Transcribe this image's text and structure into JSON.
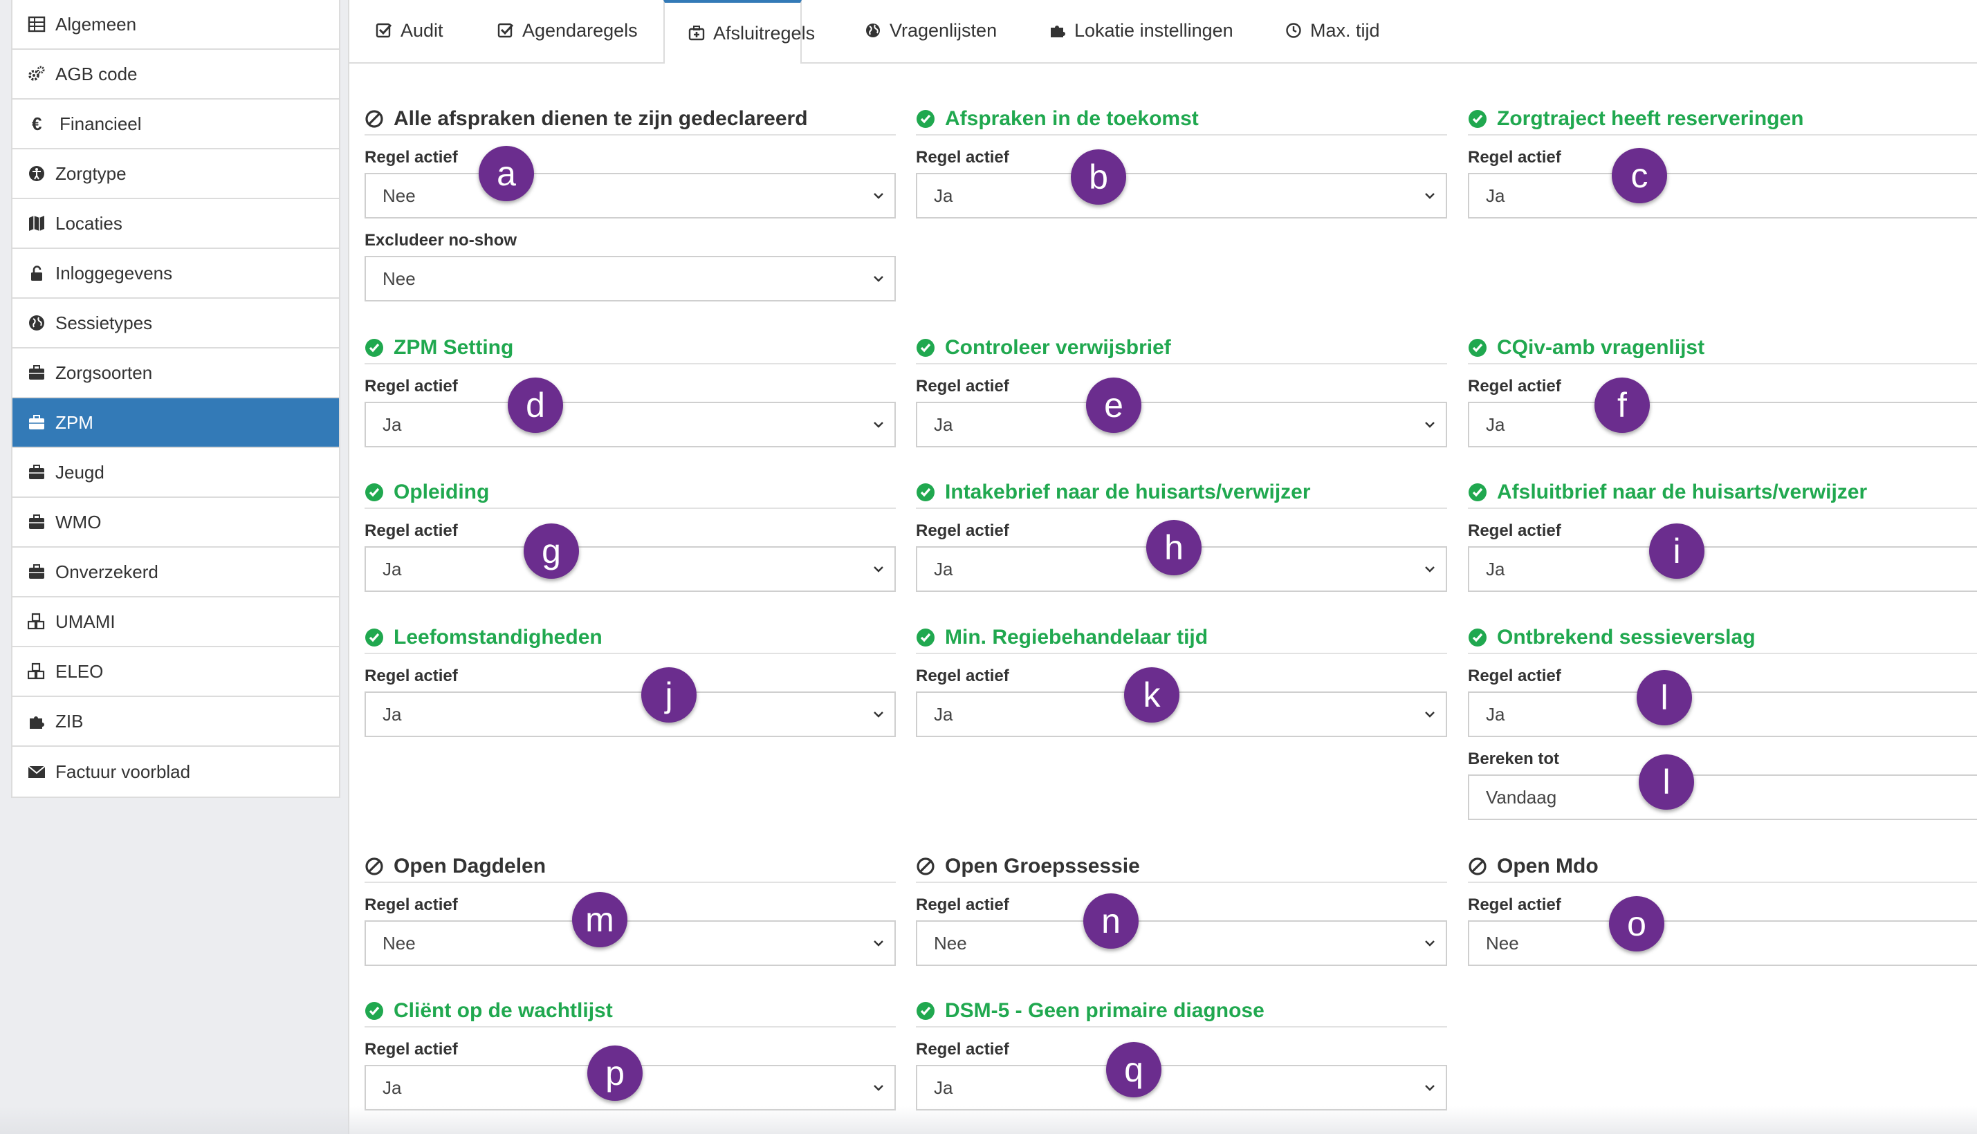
{
  "sidebar": {
    "items": [
      {
        "label": "Algemeen",
        "icon": "table-icon"
      },
      {
        "label": "AGB code",
        "icon": "gears-icon"
      },
      {
        "label": "Financieel",
        "icon": "euro-icon"
      },
      {
        "label": "Zorgtype",
        "icon": "universal-access-icon"
      },
      {
        "label": "Locaties",
        "icon": "map-icon"
      },
      {
        "label": "Inloggegevens",
        "icon": "unlock-icon"
      },
      {
        "label": "Sessietypes",
        "icon": "globe-icon"
      },
      {
        "label": "Zorgsoorten",
        "icon": "briefcase-icon"
      },
      {
        "label": "ZPM",
        "icon": "briefcase-icon",
        "active": true
      },
      {
        "label": "Jeugd",
        "icon": "briefcase-icon"
      },
      {
        "label": "WMO",
        "icon": "briefcase-icon"
      },
      {
        "label": "Onverzekerd",
        "icon": "briefcase-icon"
      },
      {
        "label": "UMAMI",
        "icon": "cubes-icon"
      },
      {
        "label": "ELEO",
        "icon": "cubes-icon"
      },
      {
        "label": "ZIB",
        "icon": "puzzle-icon"
      },
      {
        "label": "Factuur voorblad",
        "icon": "envelope-icon"
      }
    ]
  },
  "tabs": [
    {
      "label": "Audit",
      "icon": "check-square-icon"
    },
    {
      "label": "Agendaregels",
      "icon": "check-square-icon"
    },
    {
      "label": "Afsluitregels",
      "icon": "medkit-icon",
      "active": true
    },
    {
      "label": "Vragenlijsten",
      "icon": "globe-icon"
    },
    {
      "label": "Lokatie instellingen",
      "icon": "puzzle-icon"
    },
    {
      "label": "Max. tijd",
      "icon": "clock-icon"
    }
  ],
  "labels": {
    "regel_actief": "Regel actief",
    "excludeer_no_show": "Excludeer no-show",
    "bereken_tot": "Bereken tot"
  },
  "rules": [
    {
      "title": "Alle afspraken dienen te zijn gedeclareerd",
      "status": "disabled",
      "regel_actief": "Nee",
      "excludeer_no_show": "Nee",
      "marker": "a"
    },
    {
      "title": "Afspraken in de toekomst",
      "status": "enabled",
      "regel_actief": "Ja",
      "marker": "b"
    },
    {
      "title": "Zorgtraject heeft reserveringen",
      "status": "enabled",
      "regel_actief": "Ja",
      "marker": "c"
    },
    {
      "title": "ZPM Setting",
      "status": "enabled",
      "regel_actief": "Ja",
      "marker": "d"
    },
    {
      "title": "Controleer verwijsbrief",
      "status": "enabled",
      "regel_actief": "Ja",
      "marker": "e"
    },
    {
      "title": "CQiv-amb vragenlijst",
      "status": "enabled",
      "regel_actief": "Ja",
      "marker": "f"
    },
    {
      "title": "Opleiding",
      "status": "enabled",
      "regel_actief": "Ja",
      "marker": "g"
    },
    {
      "title": "Intakebrief naar de huisarts/verwijzer",
      "status": "enabled",
      "regel_actief": "Ja",
      "marker": "h"
    },
    {
      "title": "Afsluitbrief naar de huisarts/verwijzer",
      "status": "enabled",
      "regel_actief": "Ja",
      "marker": "i"
    },
    {
      "title": "Leefomstandigheden",
      "status": "enabled",
      "regel_actief": "Ja",
      "marker": "j"
    },
    {
      "title": "Min. Regiebehandelaar tijd",
      "status": "enabled",
      "regel_actief": "Ja",
      "marker": "k"
    },
    {
      "title": "Ontbrekend sessieverslag",
      "status": "enabled",
      "regel_actief": "Ja",
      "bereken_tot": "Vandaag",
      "marker": "l",
      "marker2": "l"
    },
    {
      "title": "Open Dagdelen",
      "status": "disabled",
      "regel_actief": "Nee",
      "marker": "m"
    },
    {
      "title": "Open Groepssessie",
      "status": "disabled",
      "regel_actief": "Nee",
      "marker": "n"
    },
    {
      "title": "Open Mdo",
      "status": "disabled",
      "regel_actief": "Nee",
      "marker": "o"
    },
    {
      "title": "Cliënt op de wachtlijst",
      "status": "enabled",
      "regel_actief": "Ja",
      "marker": "p"
    },
    {
      "title": "DSM-5 - Geen primaire diagnose",
      "status": "enabled",
      "regel_actief": "Ja",
      "marker": "q"
    }
  ],
  "colors": {
    "accent": "#337ab7",
    "enabled": "#20a84f",
    "disabled": "#333333",
    "marker": "#6b2d8e"
  }
}
